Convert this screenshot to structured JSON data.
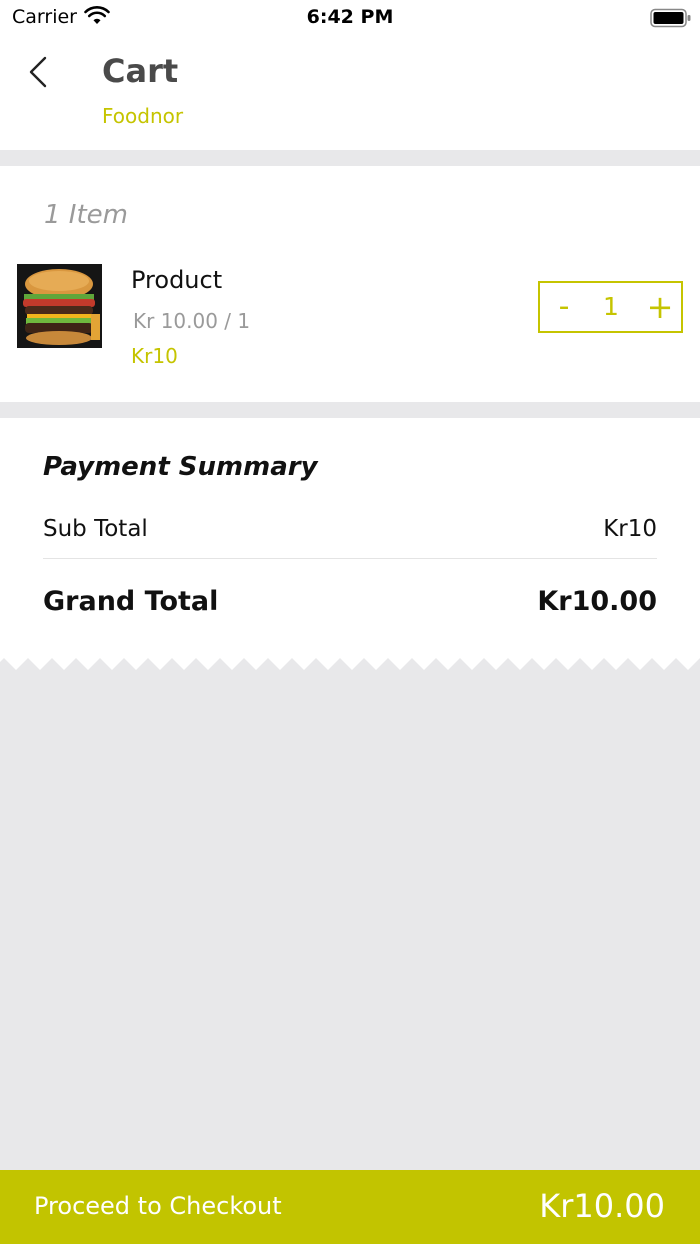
{
  "status_bar": {
    "carrier": "Carrier",
    "time": "6:42 PM"
  },
  "header": {
    "title": "Cart",
    "store": "Foodnor"
  },
  "cart": {
    "count_label": "1  Item",
    "items": [
      {
        "name": "Product",
        "unit_price": "Kr 10.00 / 1",
        "total": "Kr10",
        "quantity": "1",
        "minus_label": "-",
        "plus_label": "+"
      }
    ]
  },
  "summary": {
    "title": "Payment Summary",
    "subtotal_label": "Sub Total",
    "subtotal_value": "Kr10",
    "grand_total_label": "Grand Total",
    "grand_total_value": "Kr10.00"
  },
  "checkout": {
    "label": "Proceed to Checkout",
    "amount": "Kr10.00"
  },
  "colors": {
    "accent": "#c5c400",
    "checkout_bg": "#c2c400",
    "background": "#e8e8ea"
  },
  "icons": [
    "wifi-icon",
    "battery-icon",
    "back-chevron-icon",
    "burger-image"
  ]
}
